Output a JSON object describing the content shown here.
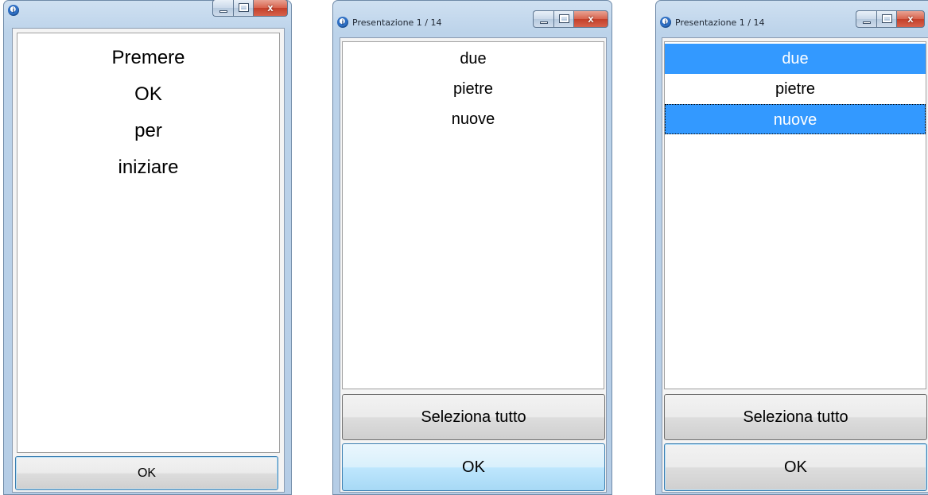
{
  "windows": [
    {
      "title": "",
      "intro_lines": [
        "Premere",
        "OK",
        "per",
        "iniziare"
      ],
      "ok_label": "OK"
    },
    {
      "title": "Presentazione 1 / 14",
      "items": [
        "due",
        "pietre",
        "nuove"
      ],
      "select_all_label": "Seleziona tutto",
      "ok_label": "OK"
    },
    {
      "title": "Presentazione 1 / 14",
      "items": [
        "due",
        "pietre",
        "nuove"
      ],
      "selected_items": [
        "due",
        "nuove"
      ],
      "select_all_label": "Seleziona tutto",
      "ok_label": "OK"
    }
  ],
  "colors": {
    "selection": "#3399ff",
    "selection_text": "#ffffff",
    "button_hover": "#bee6fd",
    "close_button": "#c4402a"
  },
  "icons": {
    "app": "info-balloon-icon",
    "minimize": "minimize-icon",
    "maximize": "maximize-icon",
    "close": "close-icon"
  }
}
